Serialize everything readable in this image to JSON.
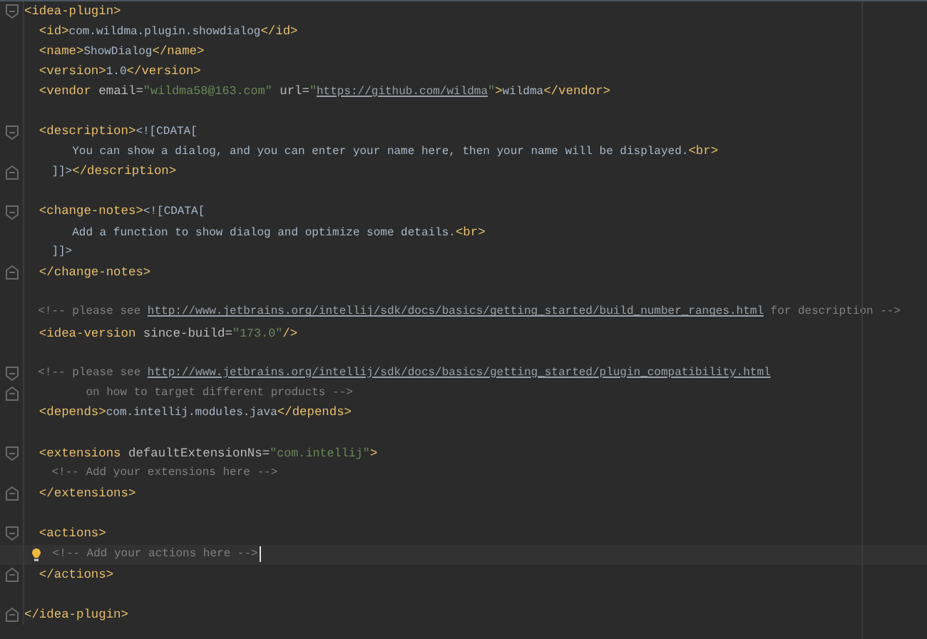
{
  "editor": {
    "lines": [
      {
        "fold_start": true,
        "fold_end": false,
        "tokens": [
          {
            "kind": "tag",
            "text": "<idea-plugin>"
          }
        ]
      },
      {
        "fold_start": false,
        "fold_end": false,
        "tokens": [
          {
            "kind": "tag",
            "text": "  <id>"
          },
          {
            "kind": "text",
            "text": "com.wildma.plugin.showdialog"
          },
          {
            "kind": "tag",
            "text": "</id>"
          }
        ]
      },
      {
        "fold_start": false,
        "fold_end": false,
        "tokens": [
          {
            "kind": "tag",
            "text": "  <name>"
          },
          {
            "kind": "text",
            "text": "ShowDialog"
          },
          {
            "kind": "tag",
            "text": "</name>"
          }
        ]
      },
      {
        "fold_start": false,
        "fold_end": false,
        "tokens": [
          {
            "kind": "tag",
            "text": "  <version>"
          },
          {
            "kind": "text",
            "text": "1.0"
          },
          {
            "kind": "tag",
            "text": "</version>"
          }
        ]
      },
      {
        "fold_start": false,
        "fold_end": false,
        "tokens": [
          {
            "kind": "tag",
            "text": "  <vendor "
          },
          {
            "kind": "attr",
            "text": "email="
          },
          {
            "kind": "string",
            "text": "\"wildma58@163.com\""
          },
          {
            "kind": "attr",
            "text": " url="
          },
          {
            "kind": "string",
            "text": "\""
          },
          {
            "kind": "link",
            "text": "https://github.com/wildma"
          },
          {
            "kind": "string",
            "text": "\""
          },
          {
            "kind": "tag",
            "text": ">"
          },
          {
            "kind": "text",
            "text": "wildma"
          },
          {
            "kind": "tag",
            "text": "</vendor>"
          }
        ]
      },
      {
        "fold_start": false,
        "fold_end": false
      },
      {
        "fold_start": true,
        "fold_end": false,
        "tokens": [
          {
            "kind": "tag",
            "text": "  <description>"
          },
          {
            "kind": "text",
            "text": "<![CDATA["
          }
        ]
      },
      {
        "fold_start": false,
        "fold_end": false,
        "tokens": [
          {
            "kind": "text",
            "text": "       You can show a dialog, and you can enter your name here, then your name will be displayed."
          },
          {
            "kind": "tag",
            "text": "<br>"
          }
        ]
      },
      {
        "fold_start": false,
        "fold_end": true,
        "tokens": [
          {
            "kind": "text",
            "text": "    ]]>"
          },
          {
            "kind": "tag",
            "text": "</description>"
          }
        ]
      },
      {
        "fold_start": false,
        "fold_end": false
      },
      {
        "fold_start": true,
        "fold_end": false,
        "tokens": [
          {
            "kind": "tag",
            "text": "  <change-notes>"
          },
          {
            "kind": "text",
            "text": "<![CDATA["
          }
        ]
      },
      {
        "fold_start": false,
        "fold_end": false,
        "tokens": [
          {
            "kind": "text",
            "text": "       Add a function to show dialog and optimize some details."
          },
          {
            "kind": "tag",
            "text": "<br>"
          }
        ]
      },
      {
        "fold_start": false,
        "fold_end": false,
        "tokens": [
          {
            "kind": "text",
            "text": "    ]]>"
          }
        ]
      },
      {
        "fold_start": false,
        "fold_end": true,
        "tokens": [
          {
            "kind": "tag",
            "text": "  </change-notes>"
          }
        ]
      },
      {
        "fold_start": false,
        "fold_end": false
      },
      {
        "fold_start": false,
        "fold_end": false,
        "tokens": [
          {
            "kind": "comment",
            "text": "  <!-- please see "
          },
          {
            "kind": "link",
            "text": "http://www.jetbrains.org/intellij/sdk/docs/basics/getting_started/build_number_ranges.html"
          },
          {
            "kind": "comment",
            "text": " for description -->"
          }
        ]
      },
      {
        "fold_start": false,
        "fold_end": false,
        "tokens": [
          {
            "kind": "tag",
            "text": "  <idea-version "
          },
          {
            "kind": "attr",
            "text": "since-build="
          },
          {
            "kind": "string",
            "text": "\"173.0\""
          },
          {
            "kind": "tag",
            "text": "/>"
          }
        ]
      },
      {
        "fold_start": false,
        "fold_end": false
      },
      {
        "fold_start": true,
        "fold_end": false,
        "tokens": [
          {
            "kind": "comment",
            "text": "  <!-- please see "
          },
          {
            "kind": "link",
            "text": "http://www.jetbrains.org/intellij/sdk/docs/basics/getting_started/plugin_compatibility.html"
          }
        ]
      },
      {
        "fold_start": false,
        "fold_end": true,
        "tokens": [
          {
            "kind": "comment",
            "text": "         on how to target different products -->"
          }
        ]
      },
      {
        "fold_start": false,
        "fold_end": false,
        "tokens": [
          {
            "kind": "tag",
            "text": "  <depends>"
          },
          {
            "kind": "text",
            "text": "com.intellij.modules.java"
          },
          {
            "kind": "tag",
            "text": "</depends>"
          }
        ]
      },
      {
        "fold_start": false,
        "fold_end": false
      },
      {
        "fold_start": true,
        "fold_end": false,
        "tokens": [
          {
            "kind": "tag",
            "text": "  <extensions "
          },
          {
            "kind": "attr",
            "text": "defaultExtensionNs="
          },
          {
            "kind": "string",
            "text": "\"com.intellij\""
          },
          {
            "kind": "tag",
            "text": ">"
          }
        ]
      },
      {
        "fold_start": false,
        "fold_end": false,
        "tokens": [
          {
            "kind": "comment",
            "text": "    <!-- Add your extensions here -->"
          }
        ]
      },
      {
        "fold_start": false,
        "fold_end": true,
        "tokens": [
          {
            "kind": "tag",
            "text": "  </extensions>"
          }
        ]
      },
      {
        "fold_start": false,
        "fold_end": false
      },
      {
        "fold_start": true,
        "fold_end": false,
        "tokens": [
          {
            "kind": "tag",
            "text": "  <actions>"
          }
        ]
      },
      {
        "current": true,
        "bulb": true,
        "fold_start": false,
        "fold_end": false,
        "tokens": [
          {
            "kind": "comment",
            "text": " <!-- Add your actions here -->"
          }
        ]
      },
      {
        "fold_start": false,
        "fold_end": true,
        "tokens": [
          {
            "kind": "tag",
            "text": "  </actions>"
          }
        ]
      },
      {
        "fold_start": false,
        "fold_end": false
      },
      {
        "fold_start": false,
        "fold_end": true,
        "tokens": [
          {
            "kind": "tag",
            "text": "</idea-plugin>"
          }
        ]
      }
    ]
  }
}
